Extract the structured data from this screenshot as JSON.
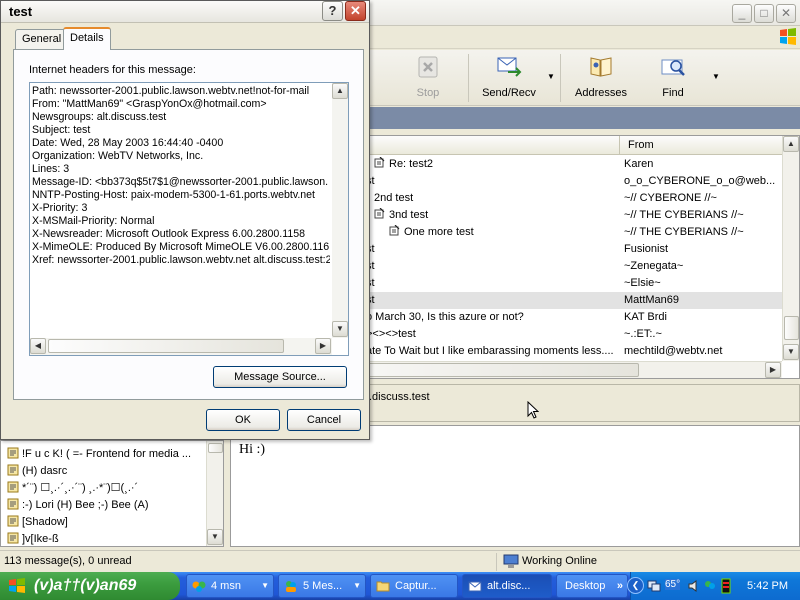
{
  "dialog": {
    "title": "test",
    "help_glyph": "?",
    "close_glyph": "✕",
    "tabs": [
      {
        "label": "General",
        "active": false
      },
      {
        "label": "Details",
        "active": true
      }
    ],
    "headers_label": "Internet headers for this message:",
    "header_lines": [
      "Path: newssorter-2001.public.lawson.webtv.net!not-for-mail",
      "From: \"MattMan69\" <GraspYonOx@hotmail.com>",
      "Newsgroups: alt.discuss.test",
      "Subject: test",
      "Date: Wed, 28 May 2003 16:44:40 -0400",
      "Organization: WebTV Networks, Inc.",
      "Lines: 3",
      "Message-ID: <bb373q$5t7$1@newssorter-2001.public.lawson.",
      "NNTP-Posting-Host: paix-modem-5300-1-61.ports.webtv.net",
      "X-Priority: 3",
      "X-MSMail-Priority: Normal",
      "X-Newsreader: Microsoft Outlook Express 6.00.2800.1158",
      "X-MimeOLE: Produced By Microsoft MimeOLE V6.00.2800.116",
      "Xref: newssorter-2001.public.lawson.webtv.net alt.discuss.test:2"
    ],
    "message_source_label": "Message Source...",
    "ok_label": "OK",
    "cancel_label": "Cancel"
  },
  "main": {
    "window_controls": [
      "_",
      "□",
      "✕"
    ],
    "toolbar": [
      {
        "label": "Stop",
        "icon": "stop-icon",
        "enabled": false
      },
      {
        "label": "Send/Recv",
        "icon": "send-receive-icon",
        "enabled": true
      },
      {
        "label": "Addresses",
        "icon": "address-book-icon",
        "enabled": true
      },
      {
        "label": "Find",
        "icon": "find-icon",
        "enabled": true
      }
    ],
    "columns": {
      "from": "From"
    },
    "messages": [
      {
        "subject": "Re: test2",
        "from": "Karen",
        "indent": 1,
        "icon": true,
        "selected": false
      },
      {
        "subject": "st",
        "from": "o_o_CYBERONE_o_o@web...",
        "indent": 0,
        "icon": false,
        "selected": false
      },
      {
        "subject": "2nd test",
        "from": "~// CYBERONE //~",
        "indent": 1,
        "icon": false,
        "selected": false
      },
      {
        "subject": "3nd test",
        "from": "~// THE CYBERIANS //~",
        "indent": 2,
        "icon": true,
        "selected": false
      },
      {
        "subject": "One more test",
        "from": "~// THE CYBERIANS //~",
        "indent": 3,
        "icon": true,
        "selected": false
      },
      {
        "subject": "st",
        "from": "Fusionist",
        "indent": 0,
        "icon": false,
        "selected": false
      },
      {
        "subject": "st",
        "from": "~Zenegata~",
        "indent": 0,
        "icon": false,
        "selected": false
      },
      {
        "subject": "st",
        "from": "~Elsie~",
        "indent": 0,
        "icon": false,
        "selected": false
      },
      {
        "subject": "st",
        "from": "MattMan69",
        "indent": 0,
        "icon": false,
        "selected": true
      },
      {
        "subject": "o March 30, Is this azure or not?",
        "from": "KAT Brdi",
        "indent": 0,
        "icon": false,
        "selected": false
      },
      {
        "subject": "><><>test",
        "from": "~.:ET:.~",
        "indent": 0,
        "icon": false,
        "selected": false
      },
      {
        "subject": "ate To Wait but I like embarassing moments less....",
        "from": "mechtild@webtv.net",
        "indent": 0,
        "icon": false,
        "selected": false
      }
    ],
    "preview": {
      "header_text": ".discuss.test",
      "body_text": "Hi :)"
    },
    "folders": [
      "!F u c K! ( =- Frontend for media ...",
      "(H) dasrc",
      "*´¨) ☐¸.·´¸.·´¨)   ¸.·*¨)☐(¸.·´",
      ":-) Lori (H) Bee ;-) Bee (A)",
      "[Shadow]",
      "]v[Ike-ß"
    ],
    "status": {
      "left": "113 message(s), 0 unread",
      "right": "Working Online"
    }
  },
  "taskbar": {
    "start_label": "(v)a††(v)an69",
    "tasks": [
      {
        "label": "4 msn",
        "count_color": "#ff3030",
        "active": false,
        "dropdown": true
      },
      {
        "label": "5 Mes...",
        "count_color": "#ff3030",
        "active": false,
        "dropdown": true
      },
      {
        "label": "Captur...",
        "active": false,
        "dropdown": false
      },
      {
        "label": "alt.disc...",
        "active": true,
        "dropdown": false
      },
      {
        "label": "Desktop",
        "active": false,
        "dropdown": false
      }
    ],
    "tray_temp": "65°",
    "clock": "5:42 PM"
  },
  "colors": {
    "dialog_bg": "#ece9d8",
    "taskbar_blue": "#245edb",
    "start_green": "#3c9d3f",
    "selected_row": "#e2e2e2"
  }
}
